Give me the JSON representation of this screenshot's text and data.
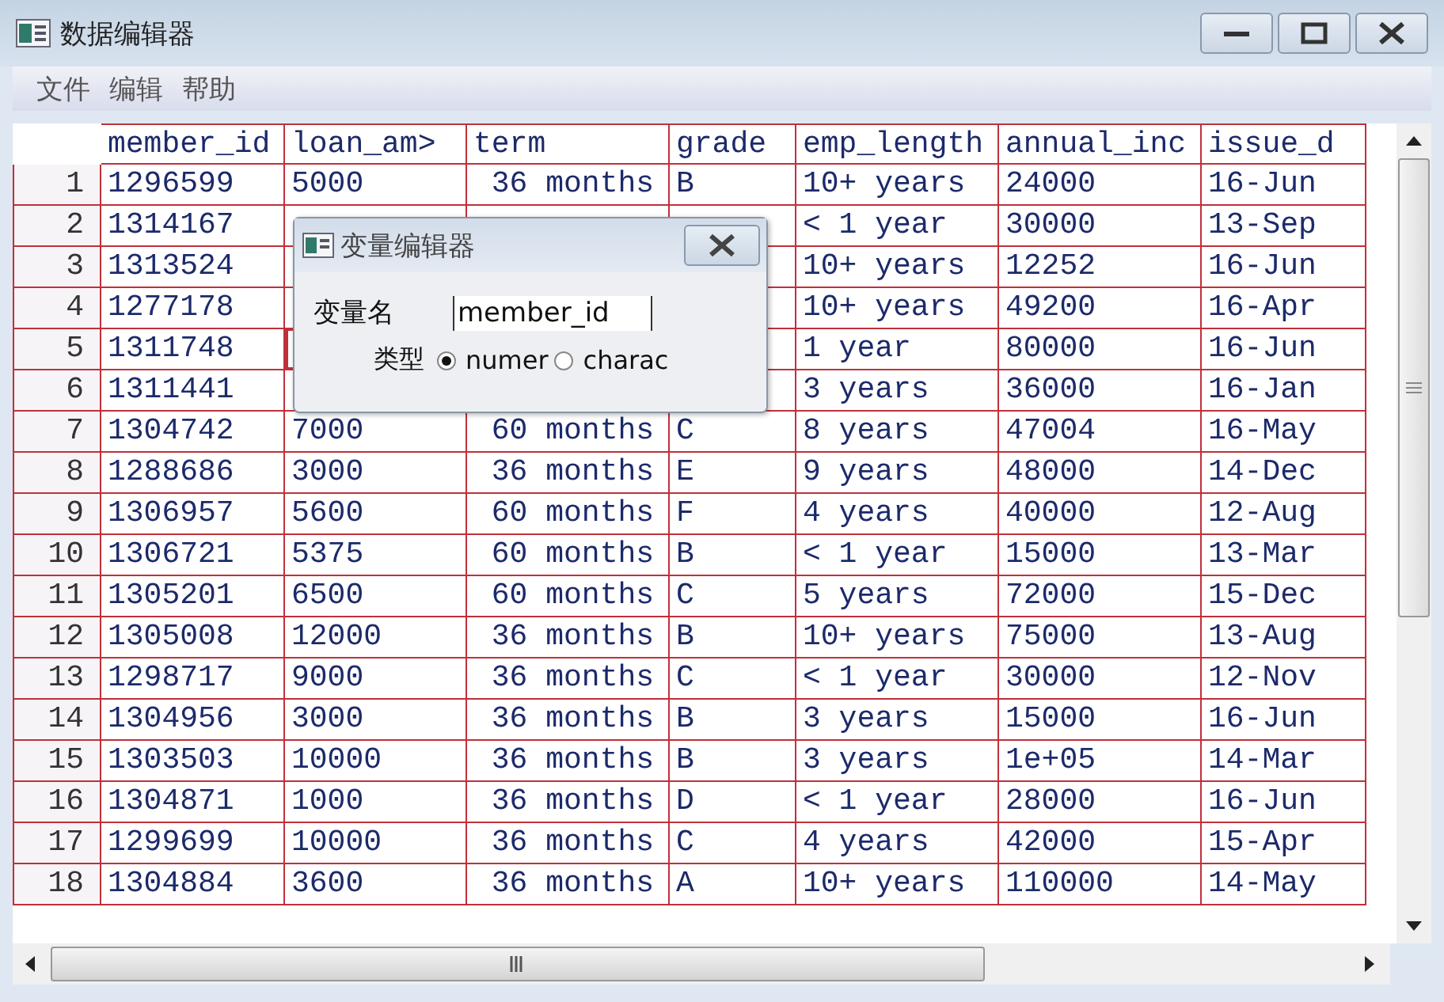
{
  "window": {
    "title": "数据编辑器"
  },
  "menu": [
    "文件",
    "编辑",
    "帮助"
  ],
  "table": {
    "columns": [
      {
        "label": "member_id",
        "selected": false
      },
      {
        "label": "loan_am>",
        "selected": true
      },
      {
        "label": "term",
        "selected": false
      },
      {
        "label": "grade",
        "selected": false
      },
      {
        "label": "emp_length",
        "selected": false
      },
      {
        "label": "annual_inc",
        "selected": false
      },
      {
        "label": "issue_d",
        "selected": false
      }
    ],
    "rows": [
      {
        "label": "1",
        "selected": false,
        "cells": [
          "1296599",
          "5000",
          " 36 months",
          "B",
          "10+ years",
          "24000",
          "16-Jun"
        ]
      },
      {
        "label": "2",
        "selected": false,
        "cells": [
          "1314167",
          null,
          null,
          null,
          "< 1 year",
          "30000",
          "13-Sep"
        ]
      },
      {
        "label": "3",
        "selected": false,
        "cells": [
          "1313524",
          null,
          null,
          null,
          "10+ years",
          "12252",
          "16-Jun"
        ]
      },
      {
        "label": "4",
        "selected": false,
        "cells": [
          "1277178",
          null,
          null,
          null,
          "10+ years",
          "49200",
          "16-Apr"
        ]
      },
      {
        "label": "5",
        "selected": true,
        "cells": [
          "1311748",
          null,
          null,
          null,
          "1 year",
          "80000",
          "16-Jun"
        ]
      },
      {
        "label": "6",
        "selected": false,
        "cells": [
          "1311441",
          null,
          null,
          null,
          "3 years",
          "36000",
          "16-Jan"
        ]
      },
      {
        "label": "7",
        "selected": false,
        "cells": [
          "1304742",
          "7000",
          " 60 months",
          "C",
          "8 years",
          "47004",
          "16-May"
        ]
      },
      {
        "label": "8",
        "selected": false,
        "cells": [
          "1288686",
          "3000",
          " 36 months",
          "E",
          "9 years",
          "48000",
          "14-Dec"
        ]
      },
      {
        "label": "9",
        "selected": false,
        "cells": [
          "1306957",
          "5600",
          " 60 months",
          "F",
          "4 years",
          "40000",
          "12-Aug"
        ]
      },
      {
        "label": "10",
        "selected": false,
        "cells": [
          "1306721",
          "5375",
          " 60 months",
          "B",
          "< 1 year",
          "15000",
          "13-Mar"
        ]
      },
      {
        "label": "11",
        "selected": false,
        "cells": [
          "1305201",
          "6500",
          " 60 months",
          "C",
          "5 years",
          "72000",
          "15-Dec"
        ]
      },
      {
        "label": "12",
        "selected": false,
        "cells": [
          "1305008",
          "12000",
          " 36 months",
          "B",
          "10+ years",
          "75000",
          "13-Aug"
        ]
      },
      {
        "label": "13",
        "selected": false,
        "cells": [
          "1298717",
          "9000",
          " 36 months",
          "C",
          "< 1 year",
          "30000",
          "12-Nov"
        ]
      },
      {
        "label": "14",
        "selected": false,
        "cells": [
          "1304956",
          "3000",
          " 36 months",
          "B",
          "3 years",
          "15000",
          "16-Jun"
        ]
      },
      {
        "label": "15",
        "selected": false,
        "cells": [
          "1303503",
          "10000",
          " 36 months",
          "B",
          "3 years",
          "1e+05",
          "14-Mar"
        ]
      },
      {
        "label": "16",
        "selected": false,
        "cells": [
          "1304871",
          "1000",
          " 36 months",
          "D",
          "< 1 year",
          "28000",
          "16-Jun"
        ]
      },
      {
        "label": "17",
        "selected": false,
        "cells": [
          "1299699",
          "10000",
          " 36 months",
          "C",
          "4 years",
          "42000",
          "15-Apr"
        ]
      },
      {
        "label": "18",
        "selected": false,
        "cells": [
          "1304884",
          "3600",
          " 36 months",
          "A",
          "10+ years",
          "110000",
          "14-May"
        ]
      }
    ]
  },
  "dialog": {
    "title": "变量编辑器",
    "name_label": "变量名",
    "name_value": "member_id",
    "type_label": "类型",
    "options": [
      {
        "label": "numer",
        "selected": true
      },
      {
        "label": "charac",
        "selected": false
      }
    ]
  }
}
